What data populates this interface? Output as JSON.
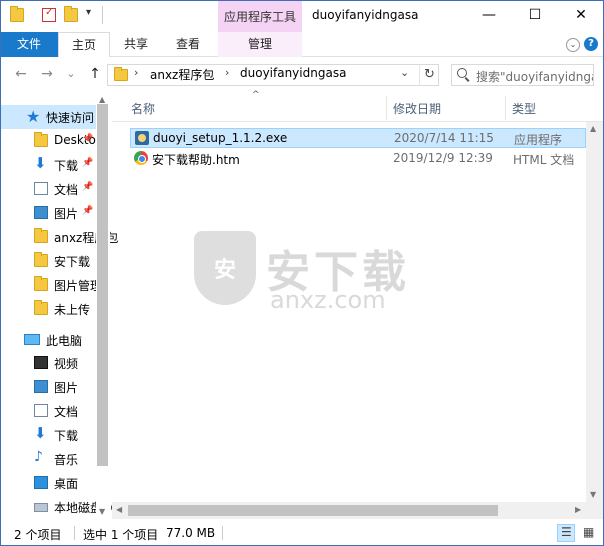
{
  "window": {
    "title": "duoyifanyidngasa",
    "context_tab_group": "应用程序工具",
    "minimize_label": "—",
    "maximize_label": "☐",
    "close_label": "✕",
    "quick_access_dropdown": "▾"
  },
  "ribbon": {
    "tabs": [
      "文件",
      "主页",
      "共享",
      "查看",
      "管理"
    ],
    "collapse_label": "⌄",
    "help_label": "?"
  },
  "nav_buttons": {
    "back": "←",
    "forward": "→",
    "recent": "⌄",
    "up": "↑"
  },
  "address": {
    "sep": "›",
    "crumbs": [
      "anxz程序包",
      "duoyifanyidngasa"
    ],
    "dropdown": "⌄",
    "refresh": "↻"
  },
  "search": {
    "placeholder": "搜索\"duoyifanyidngasa\""
  },
  "nav_pane": {
    "quick_access": "快速访问",
    "quick_items": [
      {
        "label": "Desktop",
        "icon": "folder-icon",
        "pinned": true
      },
      {
        "label": "下载",
        "icon": "download-icon",
        "pinned": true
      },
      {
        "label": "文档",
        "icon": "document-icon",
        "pinned": true
      },
      {
        "label": "图片",
        "icon": "picture-icon",
        "pinned": true
      },
      {
        "label": "anxz程序包",
        "icon": "folder-icon",
        "pinned": false
      },
      {
        "label": "安下载",
        "icon": "folder-icon",
        "pinned": false
      },
      {
        "label": "图片管理",
        "icon": "folder-icon",
        "pinned": false
      },
      {
        "label": "未上传",
        "icon": "folder-icon",
        "pinned": false
      }
    ],
    "this_pc": "此电脑",
    "pc_items": [
      {
        "label": "视频",
        "icon": "video-icon"
      },
      {
        "label": "图片",
        "icon": "picture-icon"
      },
      {
        "label": "文档",
        "icon": "document-icon"
      },
      {
        "label": "下载",
        "icon": "download-icon"
      },
      {
        "label": "音乐",
        "icon": "music-icon"
      },
      {
        "label": "桌面",
        "icon": "desktop-icon"
      },
      {
        "label": "本地磁盘 (C:)",
        "icon": "drive-icon"
      }
    ],
    "pin_glyph": "📌",
    "scroll_up": "▲",
    "scroll_down": "▼"
  },
  "columns": {
    "name": "名称",
    "date": "修改日期",
    "type": "类型",
    "sort_glyph": "^"
  },
  "files": [
    {
      "name": "duoyi_setup_1.1.2.exe",
      "date": "2020/7/14 11:15",
      "type": "应用程序",
      "icon": "exe-icon",
      "selected": true
    },
    {
      "name": "安下载帮助.htm",
      "date": "2019/12/9 12:39",
      "type": "HTML 文档",
      "icon": "html-icon",
      "selected": false
    }
  ],
  "watermark": {
    "shield_text": "安",
    "cn": "安下载",
    "en": "anxz.com"
  },
  "status": {
    "item_count": "2 个项目",
    "selected": "选中 1 个项目",
    "size": "77.0 MB"
  },
  "scrollbar_glyphs": {
    "up": "▲",
    "down": "▼",
    "left": "◀",
    "right": "▶"
  }
}
